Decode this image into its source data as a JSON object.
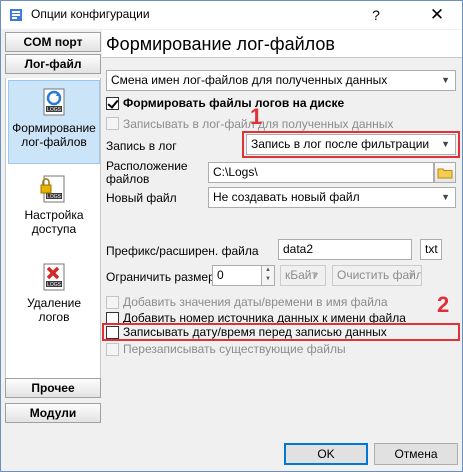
{
  "window": {
    "title": "Опции конфигурации",
    "help_glyph": "?",
    "close_glyph": "✕"
  },
  "nav": {
    "top_buttons": [
      {
        "label": "COM порт"
      },
      {
        "label": "Лог-файл"
      }
    ],
    "items": [
      {
        "label_line1": "Формирование",
        "label_line2": "лог-файлов"
      },
      {
        "label_line1": "Настройка",
        "label_line2": "доступа"
      },
      {
        "label_line1": "Удаление",
        "label_line2": "логов"
      }
    ],
    "bottom_buttons": [
      {
        "label": "Прочее"
      },
      {
        "label": "Модули"
      }
    ]
  },
  "main": {
    "title": "Формирование лог-файлов",
    "rename_combo": "Смена имен лог-файлов для полученных данных",
    "form_logs_checkbox": {
      "label": "Формировать файлы логов на диске",
      "checked": true
    },
    "write_log_file_checkbox": {
      "label": "Записывать в лог-файл для полученных данных",
      "checked": false
    },
    "write_to_log": {
      "label": "Запись в лог",
      "value": "Запись в лог после фильтрации"
    },
    "location": {
      "label_line1": "Расположение",
      "label_line2": "файлов",
      "value": "C:\\Logs\\"
    },
    "new_file": {
      "label": "Новый файл",
      "value": "Не создавать новый файл"
    },
    "prefix": {
      "label": "Префикс/расширен. файла",
      "prefix_value": "data2",
      "ext_value": "txt"
    },
    "limit": {
      "label": "Ограничить размер",
      "value": "0",
      "unit": "кБайт",
      "clear": "Очистить файл"
    },
    "options": [
      {
        "label": "Добавить значения даты/времени в имя файла",
        "checked": false,
        "enabled": false
      },
      {
        "label": "Добавить номер источника данных к имени файла",
        "checked": false,
        "enabled": true
      },
      {
        "label": "Записывать дату/время перед записью данных",
        "checked": false,
        "enabled": true
      },
      {
        "label": "Перезаписывать существующие файлы",
        "checked": false,
        "enabled": false
      }
    ],
    "marker1": "1",
    "marker2": "2"
  },
  "footer": {
    "ok": "OK",
    "cancel": "Отмена"
  },
  "colors": {
    "accent": "#0078d7",
    "highlight": "#e0303a",
    "selection": "#cce4f7"
  }
}
